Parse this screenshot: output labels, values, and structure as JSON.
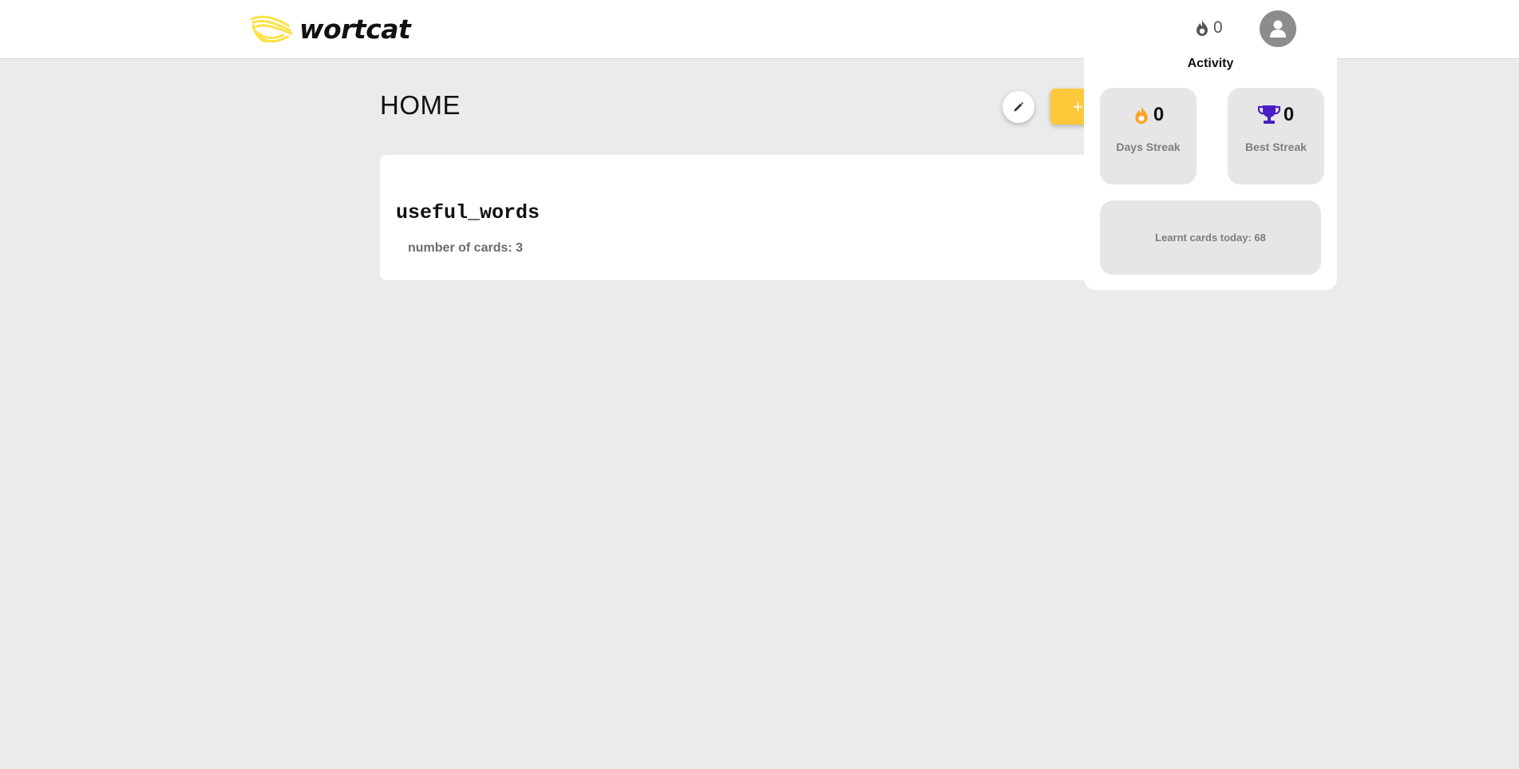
{
  "header": {
    "logo_text": "wortcat",
    "streak_count": "0",
    "brand_color": "#fde047"
  },
  "main": {
    "title": "HOME",
    "add_button_label": "+",
    "decks": [
      {
        "name": "useful_words",
        "count_label": "number of cards: 3"
      }
    ]
  },
  "activity": {
    "title": "Activity",
    "days_streak": {
      "value": "0",
      "label": "Days Streak",
      "icon": "fire-icon",
      "color": "#fca321"
    },
    "best_streak": {
      "value": "0",
      "label": "Best Streak",
      "icon": "trophy-icon",
      "color": "#4b1fc7"
    },
    "learnt_today": "Learnt cards today: 68"
  },
  "colors": {
    "background": "#ebebeb",
    "accent": "#fec83a",
    "avatar": "#8c8c8c"
  }
}
